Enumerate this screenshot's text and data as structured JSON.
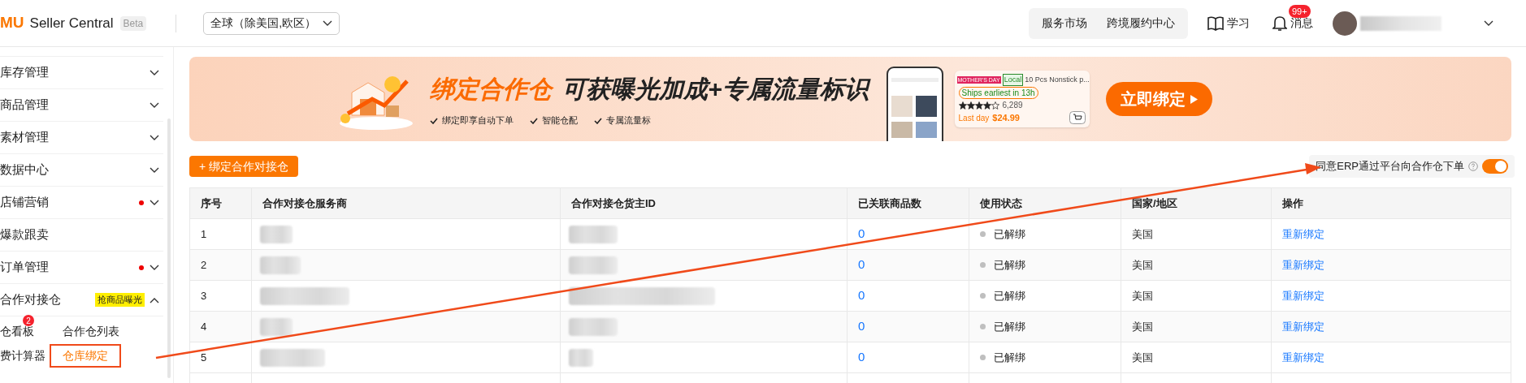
{
  "header": {
    "logo": "MU",
    "product": "Seller Central",
    "tag": "Beta",
    "region": "全球（除美国,欧区）",
    "links": [
      "服务市场",
      "跨境履约中心"
    ],
    "learn": "学习",
    "messages": {
      "label": "消息",
      "badge": "99+"
    }
  },
  "sidebar": {
    "items": [
      {
        "label": "库存管理",
        "dot": false,
        "expandable": true,
        "expanded": false
      },
      {
        "label": "商品管理",
        "dot": false,
        "expandable": true,
        "expanded": false
      },
      {
        "label": "素材管理",
        "dot": false,
        "expandable": true,
        "expanded": false
      },
      {
        "label": "数据中心",
        "dot": false,
        "expandable": true,
        "expanded": false
      },
      {
        "label": "店铺营销",
        "dot": true,
        "expandable": true,
        "expanded": false
      },
      {
        "label": "爆款跟卖",
        "dot": false,
        "expandable": false
      },
      {
        "label": "订单管理",
        "dot": true,
        "expandable": true,
        "expanded": false
      },
      {
        "label": "合作对接仓",
        "dot": false,
        "expandable": true,
        "expanded": true,
        "tag": "抢商品曝光",
        "children": [
          {
            "label": "仓看板",
            "badge": "2",
            "selected": false,
            "annotated": false
          },
          {
            "label": "合作仓列表",
            "selected": false,
            "annotated": false
          },
          {
            "label": "费计算器",
            "selected": false,
            "annotated": false
          },
          {
            "label": "仓库绑定",
            "selected": true,
            "annotated": true
          }
        ]
      }
    ]
  },
  "banner": {
    "title_accent": "绑定合作仓",
    "title": "可获曝光加成+专属流量标识",
    "bullets": [
      "绑定即享自动下单",
      "智能仓配",
      "专属流量标"
    ],
    "card": {
      "event_tag": "MOTHER'S DAY",
      "local_tag": "Local",
      "name": "10 Pcs Nonstick p...",
      "shipping": "Ships earliest in 13h",
      "stars": 4,
      "reviews": "6,289",
      "deal": "Last day",
      "price": "$24.99"
    },
    "button": "立即绑定"
  },
  "add_button": "+ 绑定合作对接仓",
  "erp_toggle": {
    "label": "同意ERP通过平台向合作仓下单",
    "on": true
  },
  "table": {
    "columns": [
      "序号",
      "合作对接仓服务商",
      "合作对接仓货主ID",
      "已关联商品数",
      "使用状态",
      "国家/地区",
      "操作"
    ],
    "rows": [
      {
        "index": "1",
        "linked": "0",
        "status": "已解绑",
        "color": "#bfbfbf",
        "country": "美国",
        "action": "重新绑定"
      },
      {
        "index": "2",
        "linked": "0",
        "status": "已解绑",
        "color": "#bfbfbf",
        "country": "美国",
        "action": "重新绑定"
      },
      {
        "index": "3",
        "linked": "0",
        "status": "已解绑",
        "color": "#bfbfbf",
        "country": "美国",
        "action": "重新绑定"
      },
      {
        "index": "4",
        "linked": "0",
        "status": "已解绑",
        "color": "#bfbfbf",
        "country": "美国",
        "action": "重新绑定"
      },
      {
        "index": "5",
        "linked": "0",
        "status": "已解绑",
        "color": "#bfbfbf",
        "country": "美国",
        "action": "重新绑定"
      }
    ]
  }
}
